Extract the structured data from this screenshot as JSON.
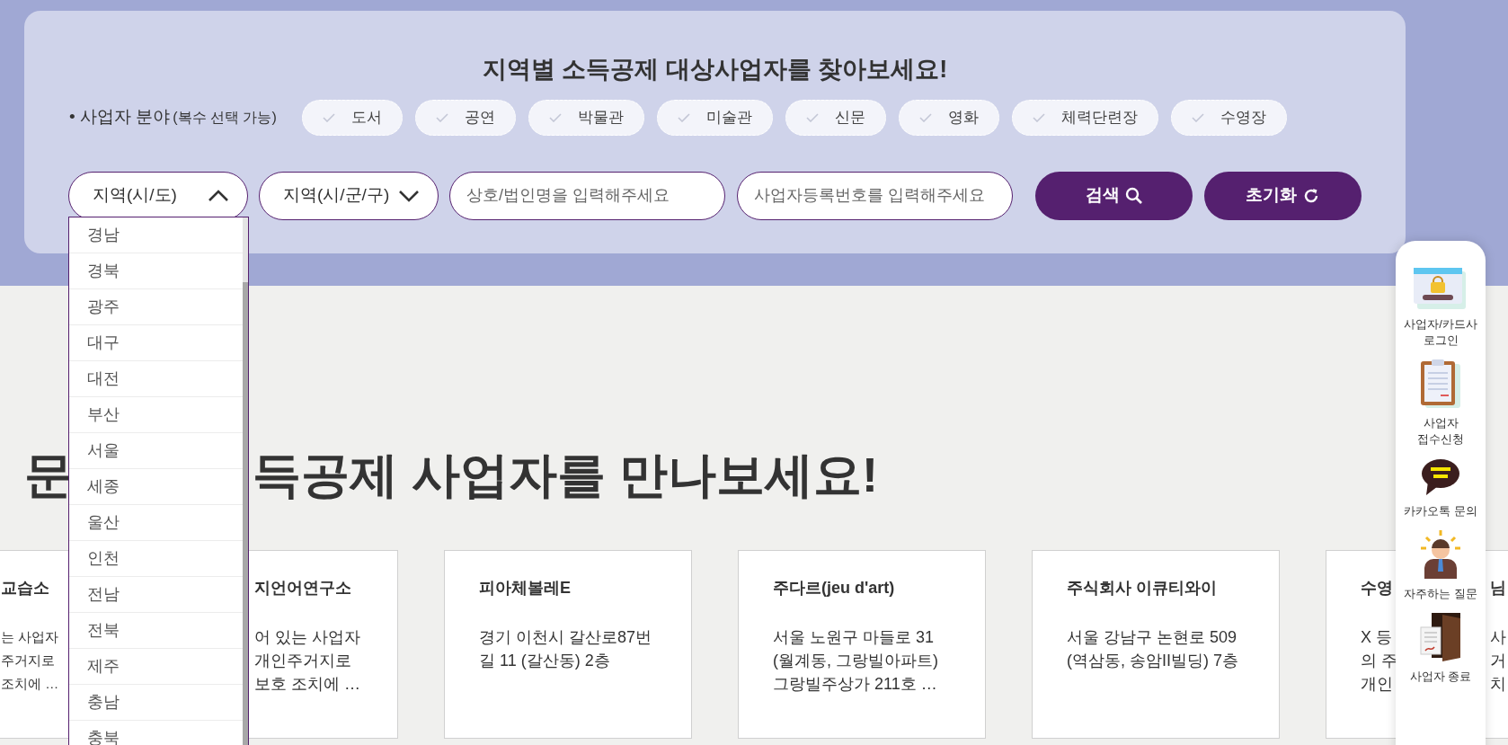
{
  "search_panel": {
    "title": "지역별 소득공제 대상사업자를 찾아보세요!",
    "category_label": "• 사업자 분야",
    "category_note": "(복수 선택 가능)",
    "categories": [
      {
        "label": "도서",
        "selected": false
      },
      {
        "label": "공연",
        "selected": false
      },
      {
        "label": "박물관",
        "selected": false
      },
      {
        "label": "미술관",
        "selected": false
      },
      {
        "label": "신문",
        "selected": false
      },
      {
        "label": "영화",
        "selected": false
      },
      {
        "label": "체력단련장",
        "selected": false
      },
      {
        "label": "수영장",
        "selected": false
      }
    ],
    "selects": [
      {
        "label": "지역(시/도)",
        "expanded": true
      },
      {
        "label": "지역(시/군/구)",
        "expanded": false
      }
    ],
    "inputs": [
      {
        "placeholder": "상호/법인명을 입력해주세요"
      },
      {
        "placeholder": "사업자등록번호를 입력해주세요"
      }
    ],
    "buttons": [
      {
        "label": "검색",
        "kind": "search"
      },
      {
        "label": "초기화",
        "kind": "reset"
      }
    ],
    "region_options": [
      "경남",
      "경북",
      "광주",
      "대구",
      "대전",
      "부산",
      "서울",
      "세종",
      "울산",
      "인천",
      "전남",
      "전북",
      "제주",
      "충남",
      "충북"
    ]
  },
  "heading": {
    "start": "문",
    "end": "득공제 사업자를 만나보세요!"
  },
  "cards": [
    {
      "title": "교습소",
      "lines": [
        "는 사업자",
        "주거지로",
        "조치에 …"
      ]
    },
    {
      "title": "지언어연구소",
      "lines": [
        "어 있는 사업자",
        "개인주거지로",
        "보호 조치에 …"
      ]
    },
    {
      "title": "피아체볼레E",
      "lines": [
        "경기 이천시 갈산로87번",
        "길 11 (갈산동) 2층"
      ]
    },
    {
      "title": "주다르(jeu d'art)",
      "lines": [
        "서울 노원구 마들로 31",
        "(월계동, 그랑빌아파트)",
        "그랑빌주상가 211호 …"
      ]
    },
    {
      "title": "주식회사 이큐티와이",
      "lines": [
        "서울 강남구 논현로 509",
        "(역삼동, 송암II빌딩) 7층"
      ]
    },
    {
      "title": "수영",
      "lines": [
        "X 등",
        "의 주",
        "개인"
      ],
      "right_title": "님",
      "right_lines": [
        "사",
        "거",
        "치"
      ]
    }
  ],
  "quick_menu": [
    {
      "label": "사업자/카드사 로그인",
      "kind": "login"
    },
    {
      "label": "사업자 접수신청",
      "kind": "apply"
    },
    {
      "label": "카카오톡 문의",
      "kind": "talk"
    },
    {
      "label": "자주하는 질문",
      "kind": "faq"
    },
    {
      "label": "사업자 종료",
      "kind": "exit"
    }
  ]
}
